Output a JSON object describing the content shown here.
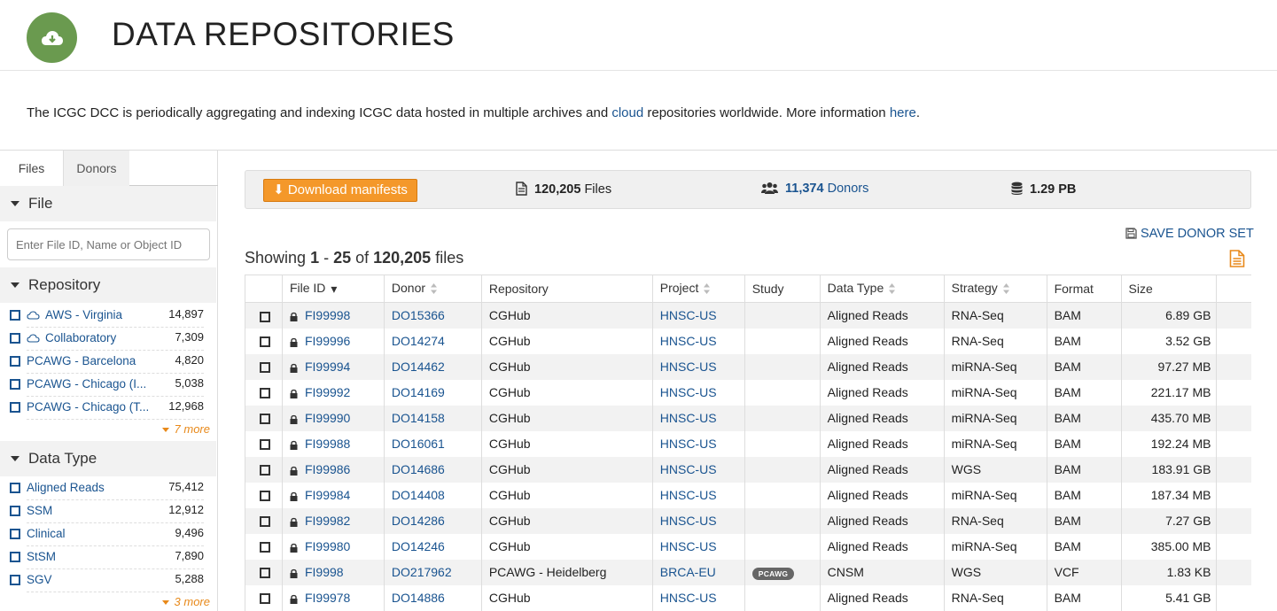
{
  "header": {
    "title": "DATA REPOSITORIES",
    "icon": "cloud-download-icon",
    "accent": "#6a9a4f"
  },
  "intro": {
    "text_before": "The ICGC DCC is periodically aggregating and indexing ICGC data hosted in multiple archives and ",
    "cloud_link": "cloud",
    "text_middle": " repositories worldwide. More information ",
    "here_link": "here",
    "text_after": "."
  },
  "sidebar": {
    "tabs": [
      {
        "label": "Files"
      },
      {
        "label": "Donors"
      }
    ],
    "file_facet": {
      "title": "File",
      "search_placeholder": "Enter File ID, Name or Object ID"
    },
    "repository_facet": {
      "title": "Repository",
      "items": [
        {
          "label": "AWS - Virginia",
          "count": "14,897",
          "icon": "cloud-icon"
        },
        {
          "label": "Collaboratory",
          "count": "7,309",
          "icon": "cloud-icon"
        },
        {
          "label": "PCAWG - Barcelona",
          "count": "4,820"
        },
        {
          "label": "PCAWG - Chicago (I...",
          "count": "5,038"
        },
        {
          "label": "PCAWG - Chicago (T...",
          "count": "12,968"
        }
      ],
      "more": "7 more"
    },
    "datatype_facet": {
      "title": "Data Type",
      "items": [
        {
          "label": "Aligned Reads",
          "count": "75,412"
        },
        {
          "label": "SSM",
          "count": "12,912"
        },
        {
          "label": "Clinical",
          "count": "9,496"
        },
        {
          "label": "StSM",
          "count": "7,890"
        },
        {
          "label": "SGV",
          "count": "5,288"
        }
      ],
      "more": "3 more"
    }
  },
  "summary": {
    "download_label": "Download manifests",
    "files_count": "120,205",
    "files_label": " Files",
    "donors_count": "11,374",
    "donors_label": " Donors",
    "size": "1.29 PB",
    "accent": "#f4982a"
  },
  "save_donor_set": "SAVE DONOR SET",
  "showing": {
    "prefix": "Showing ",
    "from": "1",
    "dash": " - ",
    "to": "25",
    "of": " of ",
    "total": "120,205",
    "suffix": " files"
  },
  "table": {
    "columns": [
      "File ID",
      "Donor",
      "Repository",
      "Project",
      "Study",
      "Data Type",
      "Strategy",
      "Format",
      "Size"
    ],
    "rows": [
      {
        "file_id": "FI99998",
        "donor": "DO15366",
        "repository": "CGHub",
        "project": "HNSC-US",
        "study": "",
        "data_type": "Aligned Reads",
        "strategy": "RNA-Seq",
        "format": "BAM",
        "size": "6.89 GB"
      },
      {
        "file_id": "FI99996",
        "donor": "DO14274",
        "repository": "CGHub",
        "project": "HNSC-US",
        "study": "",
        "data_type": "Aligned Reads",
        "strategy": "RNA-Seq",
        "format": "BAM",
        "size": "3.52 GB"
      },
      {
        "file_id": "FI99994",
        "donor": "DO14462",
        "repository": "CGHub",
        "project": "HNSC-US",
        "study": "",
        "data_type": "Aligned Reads",
        "strategy": "miRNA-Seq",
        "format": "BAM",
        "size": "97.27 MB"
      },
      {
        "file_id": "FI99992",
        "donor": "DO14169",
        "repository": "CGHub",
        "project": "HNSC-US",
        "study": "",
        "data_type": "Aligned Reads",
        "strategy": "miRNA-Seq",
        "format": "BAM",
        "size": "221.17 MB"
      },
      {
        "file_id": "FI99990",
        "donor": "DO14158",
        "repository": "CGHub",
        "project": "HNSC-US",
        "study": "",
        "data_type": "Aligned Reads",
        "strategy": "miRNA-Seq",
        "format": "BAM",
        "size": "435.70 MB"
      },
      {
        "file_id": "FI99988",
        "donor": "DO16061",
        "repository": "CGHub",
        "project": "HNSC-US",
        "study": "",
        "data_type": "Aligned Reads",
        "strategy": "miRNA-Seq",
        "format": "BAM",
        "size": "192.24 MB"
      },
      {
        "file_id": "FI99986",
        "donor": "DO14686",
        "repository": "CGHub",
        "project": "HNSC-US",
        "study": "",
        "data_type": "Aligned Reads",
        "strategy": "WGS",
        "format": "BAM",
        "size": "183.91 GB"
      },
      {
        "file_id": "FI99984",
        "donor": "DO14408",
        "repository": "CGHub",
        "project": "HNSC-US",
        "study": "",
        "data_type": "Aligned Reads",
        "strategy": "miRNA-Seq",
        "format": "BAM",
        "size": "187.34 MB"
      },
      {
        "file_id": "FI99982",
        "donor": "DO14286",
        "repository": "CGHub",
        "project": "HNSC-US",
        "study": "",
        "data_type": "Aligned Reads",
        "strategy": "RNA-Seq",
        "format": "BAM",
        "size": "7.27 GB"
      },
      {
        "file_id": "FI99980",
        "donor": "DO14246",
        "repository": "CGHub",
        "project": "HNSC-US",
        "study": "",
        "data_type": "Aligned Reads",
        "strategy": "miRNA-Seq",
        "format": "BAM",
        "size": "385.00 MB"
      },
      {
        "file_id": "FI9998",
        "donor": "DO217962",
        "repository": "PCAWG - Heidelberg",
        "project": "BRCA-EU",
        "study": "PCAWG",
        "data_type": "CNSM",
        "strategy": "WGS",
        "format": "VCF",
        "size": "1.83 KB"
      },
      {
        "file_id": "FI99978",
        "donor": "DO14886",
        "repository": "CGHub",
        "project": "HNSC-US",
        "study": "",
        "data_type": "Aligned Reads",
        "strategy": "RNA-Seq",
        "format": "BAM",
        "size": "5.41 GB"
      }
    ]
  },
  "colors": {
    "link": "#1a5490",
    "more": "#e8891a"
  }
}
